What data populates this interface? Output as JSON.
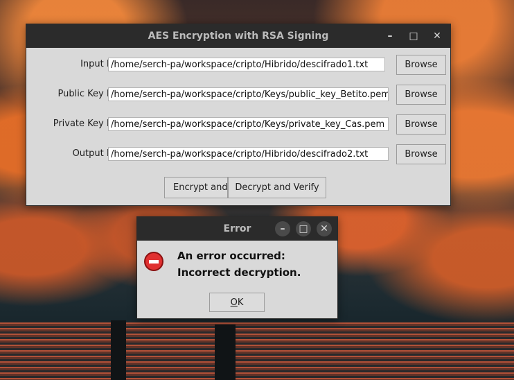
{
  "main_window": {
    "title": "AES Encryption with RSA Signing",
    "controls": {
      "minimize": "–",
      "maximize": "□",
      "close": "✕"
    },
    "rows": [
      {
        "label": "Input File:",
        "value": "/home/serch-pa/workspace/cripto/Hibrido/descifrado1.txt",
        "button": "Browse"
      },
      {
        "label": "Public Key File:",
        "value": "/home/serch-pa/workspace/cripto/Keys/public_key_Betito.pem",
        "button": "Browse"
      },
      {
        "label": "Private Key File:",
        "value": "/home/serch-pa/workspace/cripto/Keys/private_key_Cas.pem",
        "button": "Browse"
      },
      {
        "label": "Output File:",
        "value": "/home/serch-pa/workspace/cripto/Hibrido/descifrado2.txt",
        "button": "Browse"
      }
    ],
    "encrypt_button": "Encrypt and",
    "decrypt_button": "Decrypt and Verify"
  },
  "error_dialog": {
    "title": "Error",
    "controls": {
      "minimize": "–",
      "maximize": "□",
      "close": "✕"
    },
    "icon": "error-icon",
    "message": "An error occurred: Incorrect decryption.",
    "ok_prefix": "O",
    "ok_suffix": "K"
  }
}
